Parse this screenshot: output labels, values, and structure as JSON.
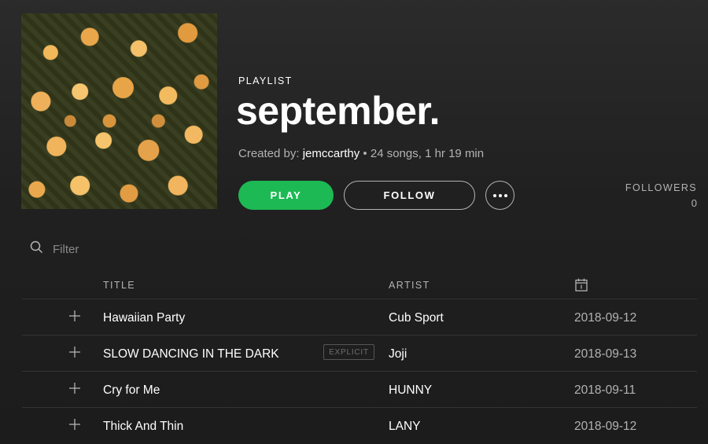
{
  "header": {
    "type_label": "PLAYLIST",
    "title": "september.",
    "created_by_label": "Created by:",
    "owner": "jemccarthy",
    "separator": "•",
    "stats": "24 songs, 1 hr 19 min",
    "play_label": "PLAY",
    "follow_label": "FOLLOW",
    "followers_label": "FOLLOWERS",
    "followers_count": "0"
  },
  "filter": {
    "placeholder": "Filter"
  },
  "columns": {
    "title": "TITLE",
    "artist": "ARTIST",
    "date_icon": "calendar-icon"
  },
  "tracks": [
    {
      "title": "Hawaiian Party",
      "artist": "Cub Sport",
      "date": "2018-09-12",
      "explicit": false
    },
    {
      "title": "SLOW DANCING IN THE DARK",
      "artist": "Joji",
      "date": "2018-09-13",
      "explicit": true,
      "explicit_label": "EXPLICIT"
    },
    {
      "title": "Cry for Me",
      "artist": "HUNNY",
      "date": "2018-09-11",
      "explicit": false
    },
    {
      "title": "Thick And Thin",
      "artist": "LANY",
      "date": "2018-09-12",
      "explicit": false
    }
  ],
  "colors": {
    "accent": "#1db954",
    "background": "#181818",
    "muted_text": "#b3b3b3"
  }
}
